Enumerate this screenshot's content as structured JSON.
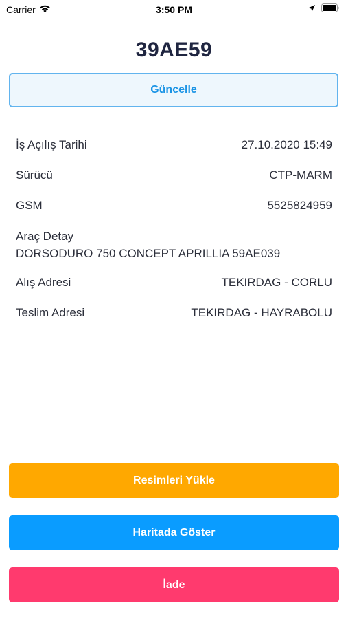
{
  "status_bar": {
    "carrier": "Carrier",
    "time": "3:50 PM",
    "icons": [
      "wifi-icon",
      "location-arrow-icon",
      "battery-icon"
    ]
  },
  "header": {
    "title": "39AE59"
  },
  "update_button": {
    "label": "Güncelle"
  },
  "details": {
    "open_date": {
      "label": "İş Açılış Tarihi",
      "value": "27.10.2020 15:49"
    },
    "driver": {
      "label": "Sürücü",
      "value": "CTP-MARM"
    },
    "gsm": {
      "label": "GSM",
      "value": "5525824959"
    },
    "vehicle": {
      "label": "Araç Detay",
      "value": "DORSODURO 750 CONCEPT APRILLIA 59AE039"
    },
    "pickup": {
      "label": "Alış Adresi",
      "value": "TEKIRDAG - CORLU"
    },
    "delivery": {
      "label": "Teslim Adresi",
      "value": "TEKIRDAG - HAYRABOLU"
    }
  },
  "actions": {
    "upload_images": {
      "label": "Resimleri Yükle",
      "color": "#ffa800"
    },
    "show_on_map": {
      "label": "Haritada Göster",
      "color": "#0a9cff"
    },
    "return": {
      "label": "İade",
      "color": "#ff3a6e"
    }
  },
  "colors": {
    "update_border": "#62b4ee",
    "update_text": "#1b94e5",
    "title_text": "#1f2540"
  }
}
